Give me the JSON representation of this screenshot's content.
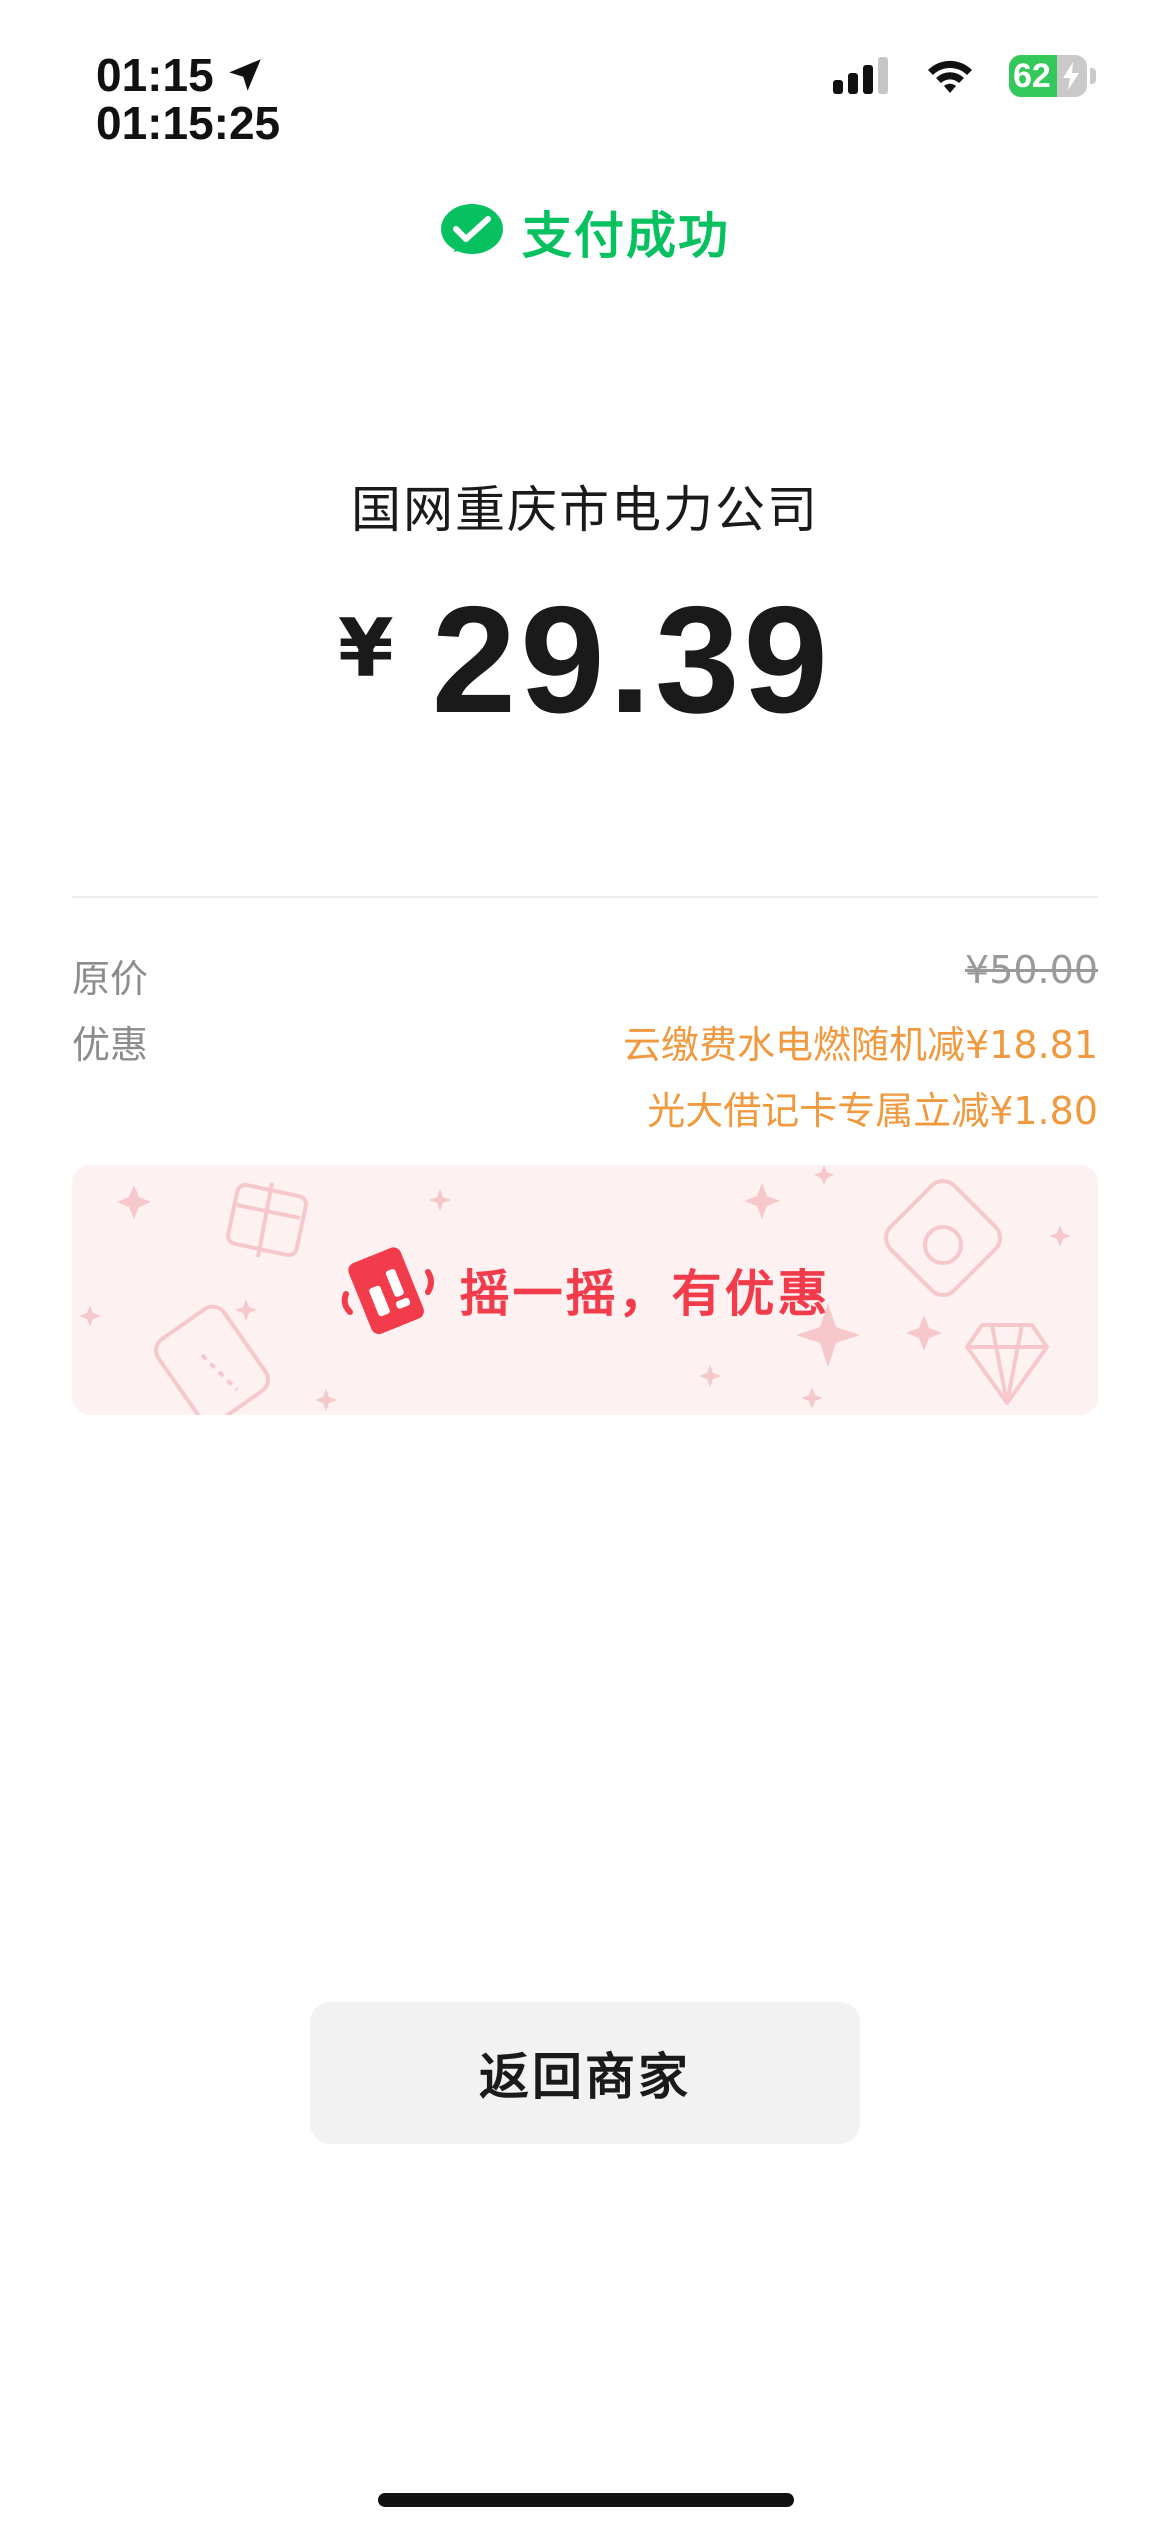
{
  "status_bar": {
    "time": "01:15",
    "time_seconds": "01:15:25",
    "battery_percent": "62",
    "battery_level": 0.62
  },
  "header": {
    "title": "支付成功"
  },
  "payment": {
    "merchant": "国网重庆市电力公司",
    "currency_symbol": "¥",
    "amount": "29.39"
  },
  "details": {
    "original_price_label": "原价",
    "original_price_value": "¥50.00",
    "discount_label": "优惠",
    "discounts": [
      "云缴费水电燃随机减¥18.81",
      "光大借记卡专属立减¥1.80"
    ]
  },
  "banner": {
    "text": "摇一摇，有优惠"
  },
  "actions": {
    "back_label": "返回商家"
  },
  "colors": {
    "success_green": "#07c160",
    "discount_orange": "#f0993e",
    "banner_red": "#f23b4b",
    "banner_bg": "#fdf1f1"
  }
}
